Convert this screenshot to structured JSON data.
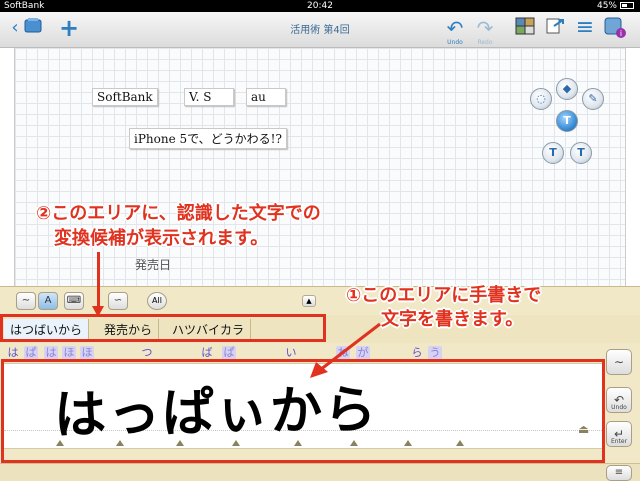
{
  "status_bar": {
    "carrier": "SoftBank",
    "time": "20:42",
    "battery": "45%"
  },
  "toolbar": {
    "title": "活用術 第4回",
    "undo_label": "Undo",
    "redo_label": "Redo",
    "icons": [
      "back-chevron-icon",
      "notebook-icon",
      "add-icon",
      "undo-icon",
      "redo-icon",
      "pages-icon",
      "export-icon",
      "menu-icon",
      "app-icon"
    ]
  },
  "canvas": {
    "boxes": [
      "SoftBank",
      "V. S",
      "au",
      "iPhone 5で、どうかわる!?"
    ],
    "partial_text": "発売日"
  },
  "palette": {
    "icons": [
      "lasso-icon",
      "eraser-icon",
      "pen-icon",
      "text-icon",
      "text-plus-icon",
      "text-minus-icon"
    ],
    "text_label": "T"
  },
  "hw_panel": {
    "all_label": "All",
    "candidates": [
      "はつばいから",
      "発売から",
      "ハツバイカラ"
    ],
    "stroke_chars": [
      "は",
      "ぱ",
      "は",
      "ほ",
      "ほ",
      "つ",
      "ば",
      "ぱ",
      "い",
      "ね",
      "が",
      "ら",
      "う"
    ],
    "ink_text": "はっぱぃから",
    "enter_label": "Enter",
    "undo_label": "Undo"
  },
  "annotations": {
    "note1_line1": "①このエリアに手書きで",
    "note1_line2": "文字を書きます。",
    "note2_line1": "②このエリアに、認識した文字での",
    "note2_line2": "変換候補が表示されます。"
  },
  "colors": {
    "accent": "#2d7fc1",
    "annotation": "#e0321f",
    "panel": "#f1e8c8"
  }
}
